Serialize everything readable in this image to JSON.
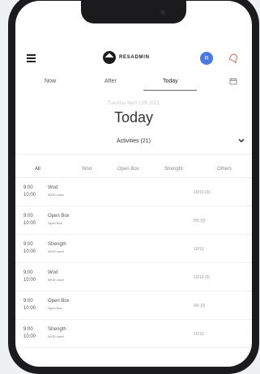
{
  "logo": {
    "text": "RESADMIN"
  },
  "header": {
    "avatar_initial": "R"
  },
  "tabs": [
    {
      "label": "Now"
    },
    {
      "label": "After"
    },
    {
      "label": "Today"
    }
  ],
  "date_line": "Tuesday April 13th 2021",
  "title": "Today",
  "activities": "Activities (21)",
  "filters": [
    {
      "label": "All"
    },
    {
      "label": "Wod"
    },
    {
      "label": "Open Box"
    },
    {
      "label": "Strenght"
    },
    {
      "label": "Others"
    }
  ],
  "rows": [
    {
      "start": "9:00",
      "end": "10:00",
      "title": "Wod",
      "sub": "WOD court",
      "count": "10/10 (0)"
    },
    {
      "start": "9:00",
      "end": "10:00",
      "title": "Open Box",
      "sub": "Open Box",
      "count": "5/5 (0)"
    },
    {
      "start": "9:00",
      "end": "10:00",
      "title": "Strength",
      "sub": "WOD court",
      "count": "10/10"
    },
    {
      "start": "9:00",
      "end": "10:00",
      "title": "Wod",
      "sub": "WOD court",
      "count": "10/10 (0)"
    },
    {
      "start": "9:00",
      "end": "10:00",
      "title": "Open Box",
      "sub": "Open Box",
      "count": "6/6 (0)"
    },
    {
      "start": "9:00",
      "end": "10:00",
      "title": "Strength",
      "sub": "WOD court",
      "count": "10/10"
    }
  ],
  "icons": {
    "menu": "menu-icon",
    "bell": "bell-icon",
    "calendar": "calendar-icon",
    "chevron": "chevron-down-icon"
  },
  "colors": {
    "avatar": "#4a78e8",
    "bell": "#d48a7c",
    "frame": "#1b1b1d",
    "background": "#eef1f3"
  }
}
